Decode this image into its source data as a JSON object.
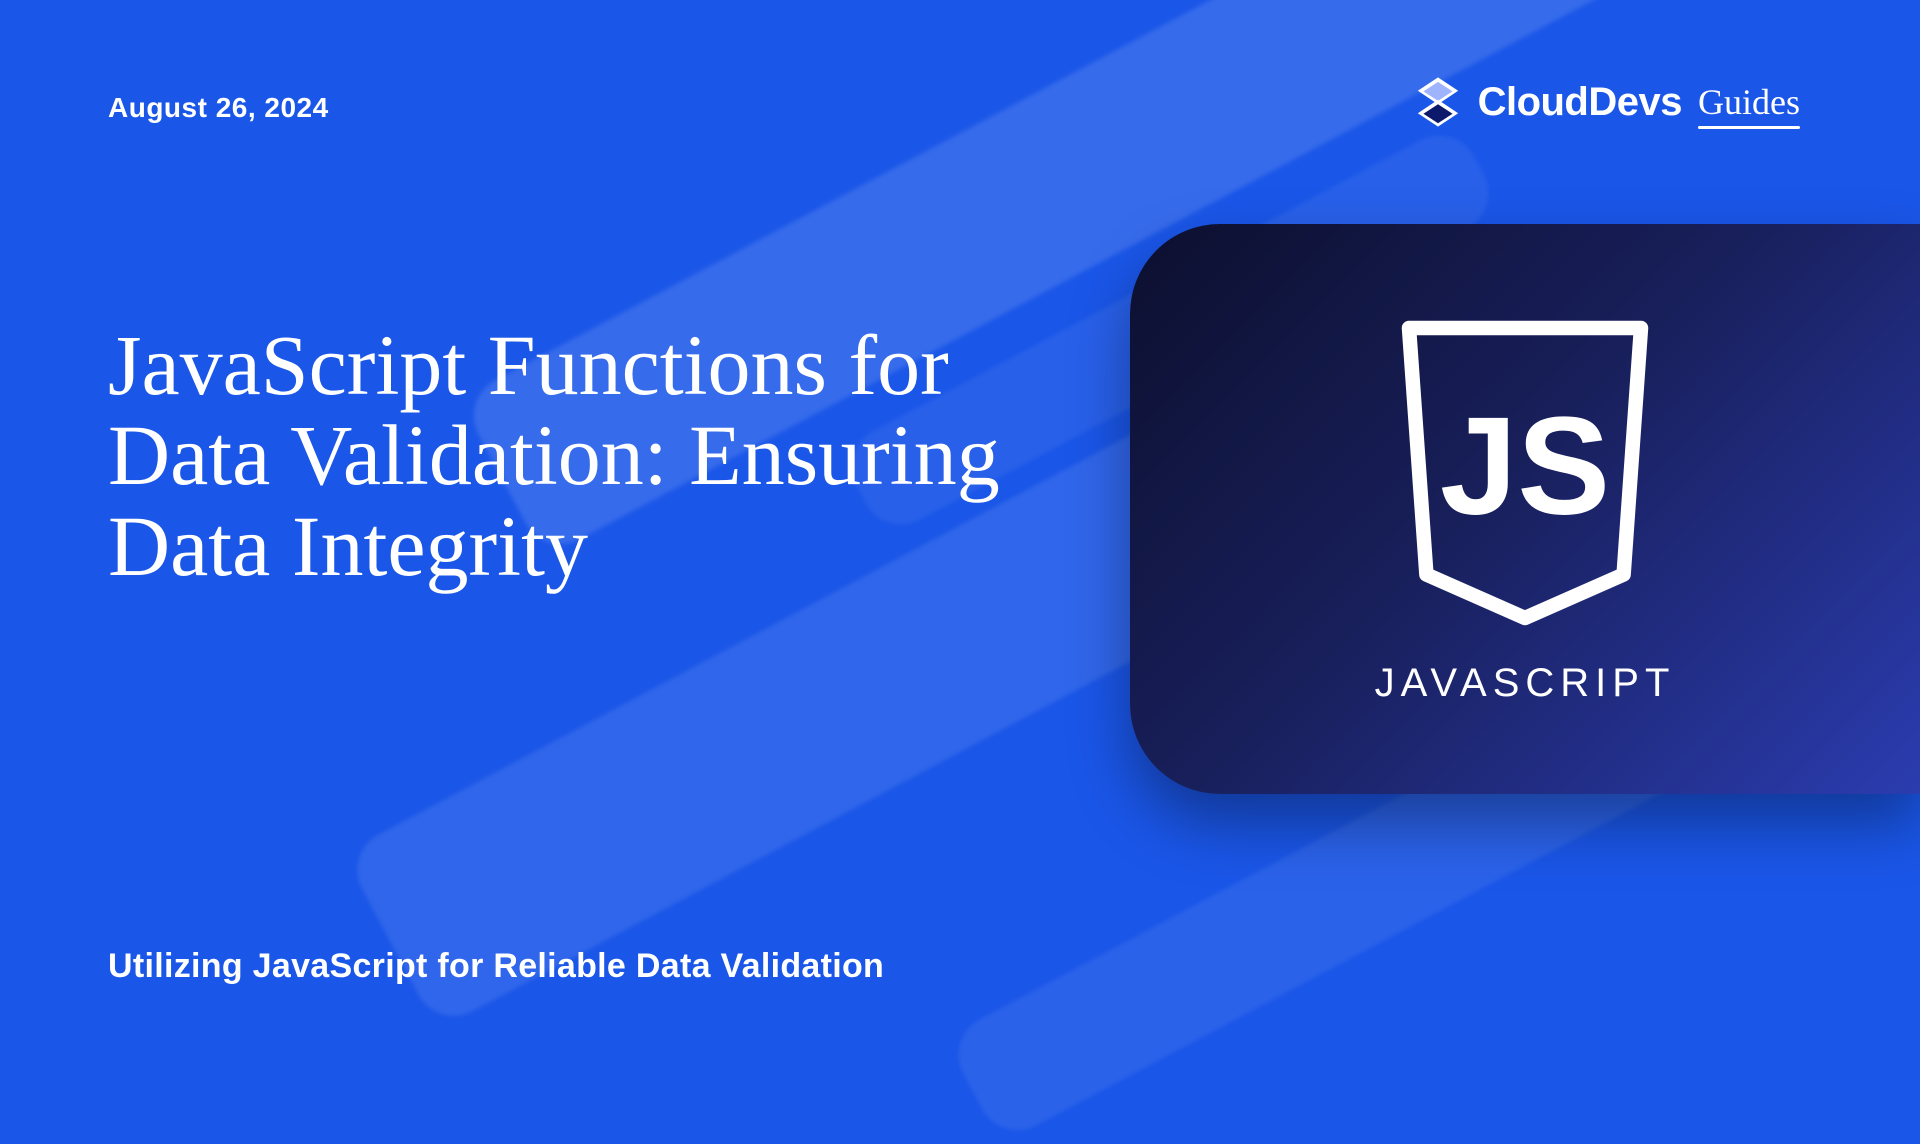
{
  "date": "August 26,  2024",
  "brand": {
    "name": "CloudDevs",
    "suffix": "Guides"
  },
  "title": "JavaScript Functions for Data Validation: Ensuring Data Integrity",
  "subtitle": "Utilizing JavaScript for Reliable Data Validation",
  "js_badge": {
    "shield_text": "JS",
    "caption": "JAVASCRIPT"
  }
}
